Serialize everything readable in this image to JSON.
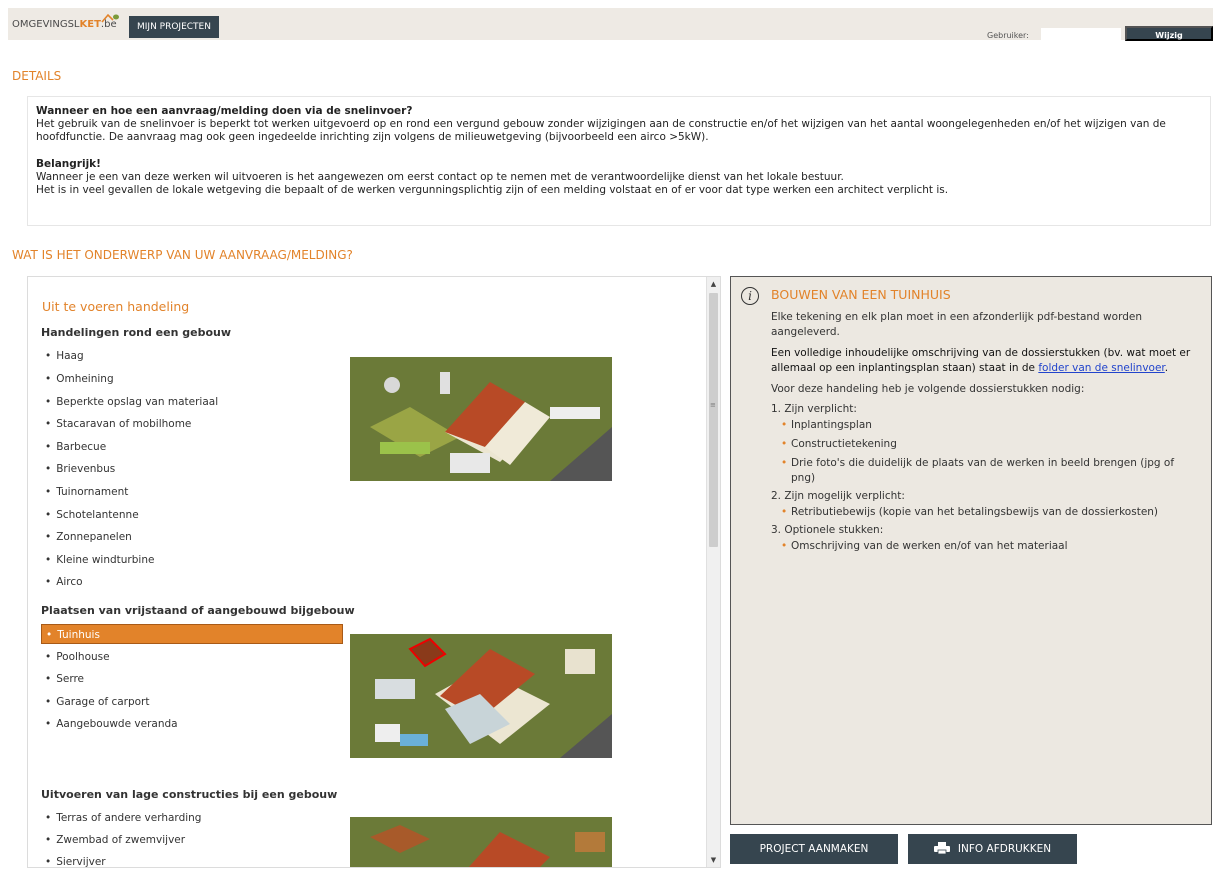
{
  "header": {
    "logo_text_a": "OMGEVINGSL",
    "logo_text_b": "KET",
    "logo_text_c": ".be",
    "projecten_button": "MIJN PROJECTEN",
    "user_label": "Gebruiker:",
    "werkrelatie_button": "Wijzig Werkrelatie"
  },
  "details": {
    "title": "DETAILS",
    "q1": "Wanneer en hoe een aanvraag/melding doen via de snelinvoer?",
    "p1": "Het gebruik van de snelinvoer is beperkt tot werken uitgevoerd op en rond een vergund gebouw zonder wijzigingen aan de constructie en/of het wijzigen van het aantal woongelegenheden en/of het wijzigen van de hoofdfunctie. De aanvraag mag ook geen ingedeelde inrichting zijn volgens de milieuwetgeving (bijvoorbeeld een airco >5kW).",
    "q2": "Belangrijk!",
    "p2": "Wanneer je een van deze werken wil uitvoeren is het aangewezen om eerst contact op te nemen met de verantwoordelijke dienst van het lokale bestuur.",
    "p3": "Het is in veel gevallen de lokale wetgeving die bepaalt of de werken vergunningsplichtig zijn of een melding volstaat en of er voor dat type werken een architect verplicht is."
  },
  "onderwerp": {
    "title": "WAT IS HET ONDERWERP VAN UW AANVRAAG/MELDING?"
  },
  "list": {
    "heading": "Uit te voeren handeling",
    "groups": [
      {
        "title": "Handelingen rond een gebouw",
        "items": [
          "Haag",
          "Omheining",
          "Beperkte opslag van materiaal",
          "Stacaravan of mobilhome",
          "Barbecue",
          "Brievenbus",
          "Tuinornament",
          "Schotelantenne",
          "Zonnepanelen",
          "Kleine windturbine",
          "Airco"
        ]
      },
      {
        "title": "Plaatsen van vrijstaand of aangebouwd bijgebouw",
        "items": [
          "Tuinhuis",
          "Poolhouse",
          "Serre",
          "Garage of carport",
          "Aangebouwde veranda"
        ]
      },
      {
        "title": "Uitvoeren van lage constructies bij een gebouw",
        "items": [
          "Terras of andere verharding",
          "Zwembad of zwemvijver",
          "Siervijver"
        ]
      }
    ],
    "selected": "Tuinhuis"
  },
  "info": {
    "title": "BOUWEN VAN EEN TUINHUIS",
    "p1": "Elke tekening en elk plan moet in een afzonderlijk pdf-bestand worden aangeleverd.",
    "p2_text": "Een volledige inhoudelijke omschrijving van de dossierstukken (bv. wat moet er allemaal op een inplantingsplan staan) staat in de ",
    "p2_link": "folder van de snelinvoer",
    "p2_end": ".",
    "p3": "Voor deze handeling heb je volgende dossierstukken nodig:",
    "sec1": "1. Zijn verplicht:",
    "sec1_items": [
      "Inplantingsplan",
      "Constructietekening",
      "Drie foto's die duidelijk de plaats van de werken in beeld brengen (jpg of png)"
    ],
    "sec2": "2. Zijn mogelijk verplicht:",
    "sec2_items": [
      "Retributiebewijs (kopie van het betalingsbewijs van de dossierkosten)"
    ],
    "sec3": "3. Optionele stukken:",
    "sec3_items": [
      "Omschrijving van de werken en/of van het materiaal"
    ]
  },
  "actions": {
    "aanmaken": "PROJECT AANMAKEN",
    "afdrukken": "INFO AFDRUKKEN"
  },
  "colors": {
    "accent": "#e2832a",
    "dark_button": "#36454f",
    "info_bg": "#ece8e1"
  }
}
